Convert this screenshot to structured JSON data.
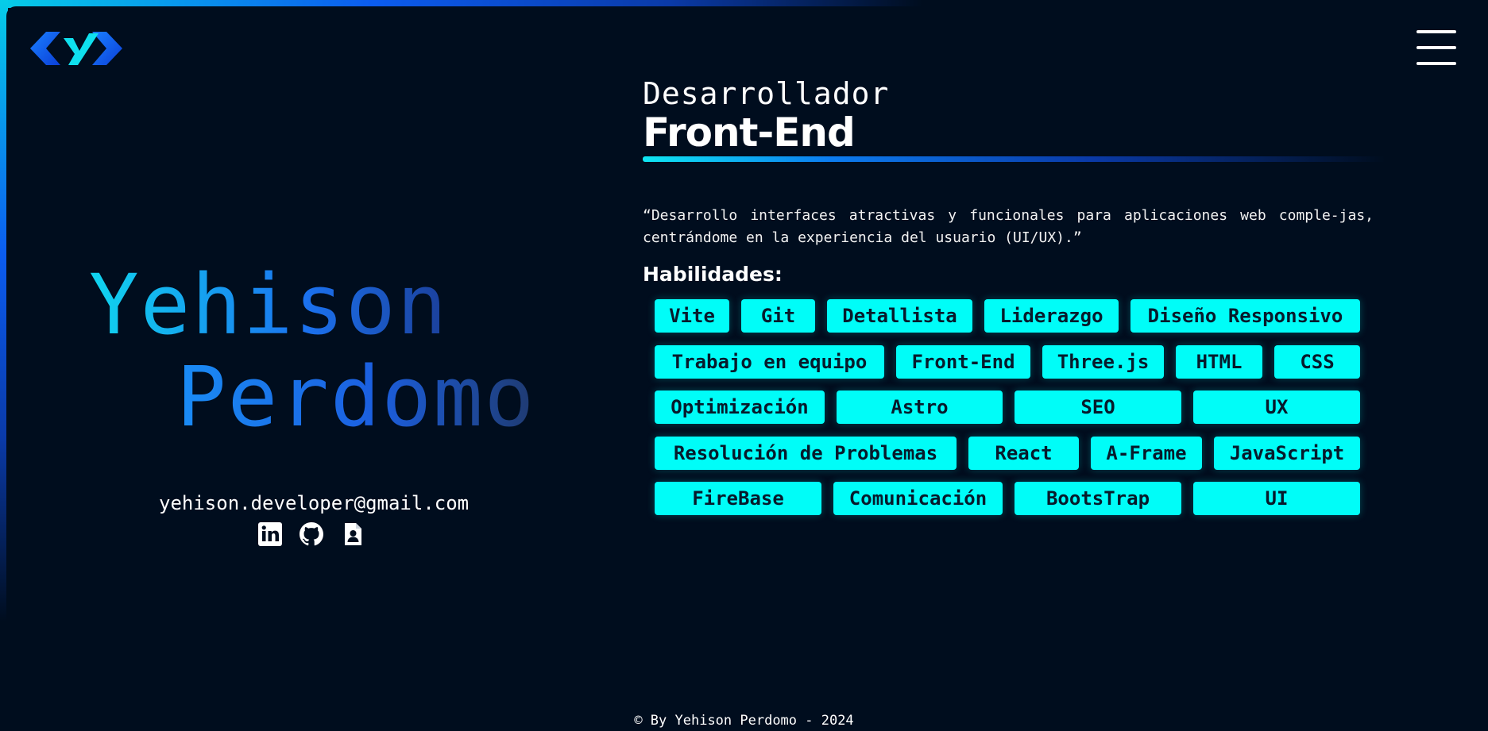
{
  "header": {
    "logo_icon": "code-brackets-logo",
    "menu_icon": "hamburger-icon"
  },
  "profile": {
    "first_name": "Yehison",
    "last_name": "Perdomo",
    "email": "yehison.developer@gmail.com",
    "socials": [
      {
        "icon": "linkedin-icon"
      },
      {
        "icon": "github-icon"
      },
      {
        "icon": "resume-icon"
      }
    ]
  },
  "hero": {
    "subtitle": "Desarrollador",
    "title": "Front-End",
    "quote": "“Desarrollo interfaces atractivas y funcionales para aplicaciones web comple-jas, centrándome en la experiencia del usuario (UI/UX).”",
    "skills_heading": "Habilidades:",
    "skills": [
      "Vite",
      "Git",
      "Detallista",
      "Liderazgo",
      "Diseño Responsivo",
      "Trabajo en equipo",
      "Front-End",
      "Three.js",
      "HTML",
      "CSS",
      "Optimización",
      "Astro",
      "SEO",
      "UX",
      "Resolución de Problemas",
      "React",
      "A-Frame",
      "JavaScript",
      "FireBase",
      "Comunicación",
      "BootsTrap",
      "UI"
    ]
  },
  "footer": {
    "text": "© By Yehison Perdomo - 2024"
  },
  "colors": {
    "background": "#000d1e",
    "chip": "#00fdf8",
    "chip_text": "#071a2b",
    "accent_cyan": "#10d6ef",
    "accent_blue": "#1b5fe0"
  }
}
